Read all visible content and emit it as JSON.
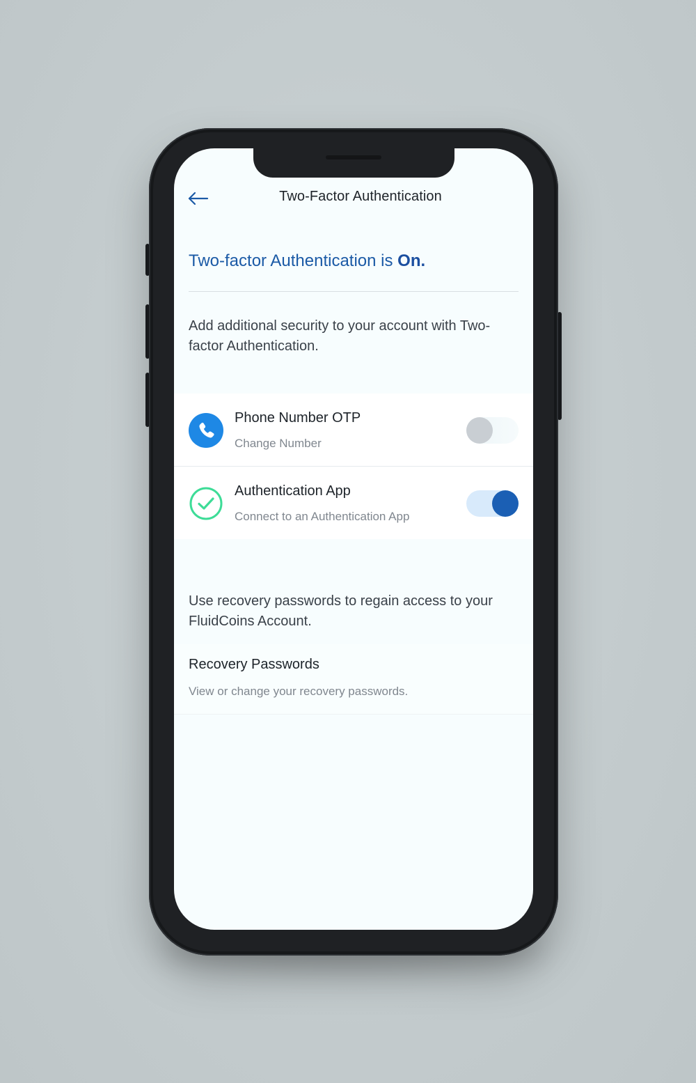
{
  "header": {
    "title": "Two-Factor Authentication",
    "back_icon": "arrow-left-icon"
  },
  "status": {
    "prefix": "Two-factor Authentication is ",
    "state": "On."
  },
  "intro": {
    "text": "Add additional security to your account with Two-factor Authentication."
  },
  "options": [
    {
      "title": "Phone Number OTP",
      "subtitle": "Change Number",
      "icon": "phone-icon",
      "enabled": false
    },
    {
      "title": "Authentication App",
      "subtitle": "Connect to an Authentication App",
      "icon": "check-circle-icon",
      "enabled": true
    }
  ],
  "recovery": {
    "text": "Use recovery passwords to regain access to your FluidCoins Account.",
    "title": "Recovery Passwords",
    "subtitle": "View or change your recovery passwords."
  },
  "colors": {
    "accent": "#1b5fb4",
    "status_blue": "#1b5aa6",
    "phone_icon_bg": "#1e88e5",
    "check_green": "#3ddc97"
  }
}
